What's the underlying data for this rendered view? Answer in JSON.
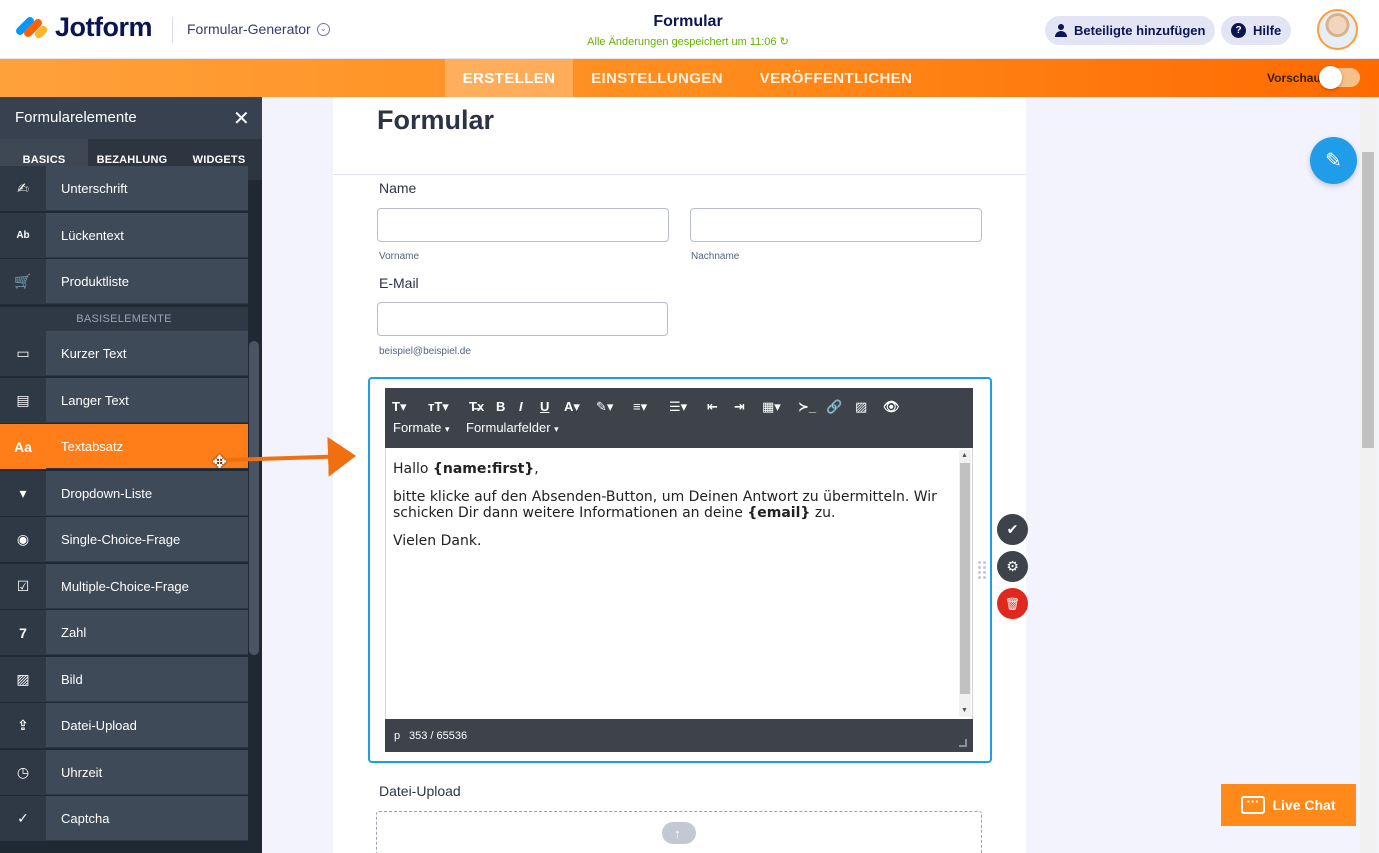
{
  "header": {
    "logo_text": "Jotform",
    "generator_label": "Formular-Generator",
    "generator_chevron": "⌄",
    "doc_title": "Formular",
    "saved_status": "Alle Änderungen gespeichert um 11:06 ↻",
    "add_participants_label": "Beteiligte hinzufügen",
    "help_label": "Hilfe",
    "help_icon_glyph": "?"
  },
  "nav": {
    "tabs": [
      {
        "label": "ERSTELLEN",
        "active": true
      },
      {
        "label": "EINSTELLUNGEN",
        "active": false
      },
      {
        "label": "VERÖFFENTLICHEN",
        "active": false
      }
    ],
    "preview_label": "Vorschau",
    "preview_on": false
  },
  "panel": {
    "title": "Formularelemente",
    "close_glyph": "✕",
    "tabs": [
      "BASICS",
      "BEZAHLUNG",
      "WIDGETS"
    ],
    "items_top": [
      {
        "label": "Unterschrift",
        "icon": "signature-icon",
        "glyph": "✍"
      },
      {
        "label": "Lückentext",
        "icon": "fill-blank-icon",
        "glyph": "Ab"
      },
      {
        "label": "Produktliste",
        "icon": "cart-icon",
        "glyph": "🛒"
      }
    ],
    "section_label": "BASISELEMENTE",
    "items": [
      {
        "label": "Kurzer Text",
        "icon": "short-text-icon",
        "glyph": "▭"
      },
      {
        "label": "Langer Text",
        "icon": "long-text-icon",
        "glyph": "▤"
      },
      {
        "label": "Textabsatz",
        "icon": "paragraph-icon",
        "glyph": "Aa",
        "active": true
      },
      {
        "label": "Dropdown-Liste",
        "icon": "dropdown-icon",
        "glyph": "▾"
      },
      {
        "label": "Single-Choice-Frage",
        "icon": "radio-icon",
        "glyph": "◉"
      },
      {
        "label": "Multiple-Choice-Frage",
        "icon": "checkbox-icon",
        "glyph": "☑"
      },
      {
        "label": "Zahl",
        "icon": "number-icon",
        "glyph": "7"
      },
      {
        "label": "Bild",
        "icon": "image-icon",
        "glyph": "▨"
      },
      {
        "label": "Datei-Upload",
        "icon": "file-upload-icon",
        "glyph": "⇪"
      },
      {
        "label": "Uhrzeit",
        "icon": "clock-icon",
        "glyph": "◷"
      },
      {
        "label": "Captcha",
        "icon": "captcha-icon",
        "glyph": "✓"
      }
    ]
  },
  "form": {
    "heading": "Formular",
    "name_label": "Name",
    "first_sub": "Vorname",
    "last_sub": "Nachname",
    "email_label": "E-Mail",
    "email_sub": "beispiel@beispiel.de",
    "upload_label": "Datei-Upload",
    "upload_icon_glyph": "↑"
  },
  "editor": {
    "toolbar_row1": [
      "T▾",
      "ᴛT▾",
      "T̶x",
      "B",
      "I",
      "U",
      "A▾",
      "✎▾",
      "≡▾",
      "☰▾",
      "⇤",
      "⇥",
      "▦▾",
      "≻_",
      "🔗",
      "▨",
      "👁"
    ],
    "formats_label": "Formate",
    "fields_label": "Formularfelder",
    "dropdown_caret": "▾",
    "line1_prefix": "Hallo ",
    "line1_token": "{name:first}",
    "line1_suffix": ",",
    "line2_prefix": "bitte klicke auf den Absenden-Button, um Deinen Antwort zu übermitteln. Wir schicken Dir dann weitere Informationen an deine ",
    "line2_token": "{email}",
    "line2_suffix": " zu.",
    "line3": "Vielen Dank.",
    "status_tag": "p",
    "status_count": "353 / 65536",
    "scroll_up_glyph": "▲",
    "scroll_down_glyph": "▼"
  },
  "actions": {
    "confirm_glyph": "✔",
    "settings_glyph": "⚙",
    "delete_glyph": "🗑"
  },
  "right": {
    "live_chat_label": "Live Chat",
    "paint_glyph": "✎"
  },
  "misc": {
    "move_cursor_glyph": "✥"
  },
  "colors": {
    "accent_orange": "#ff7e1a",
    "accent_blue": "#1f9de8",
    "delete_red": "#e0281e",
    "panel_dark": "#1f2933"
  }
}
